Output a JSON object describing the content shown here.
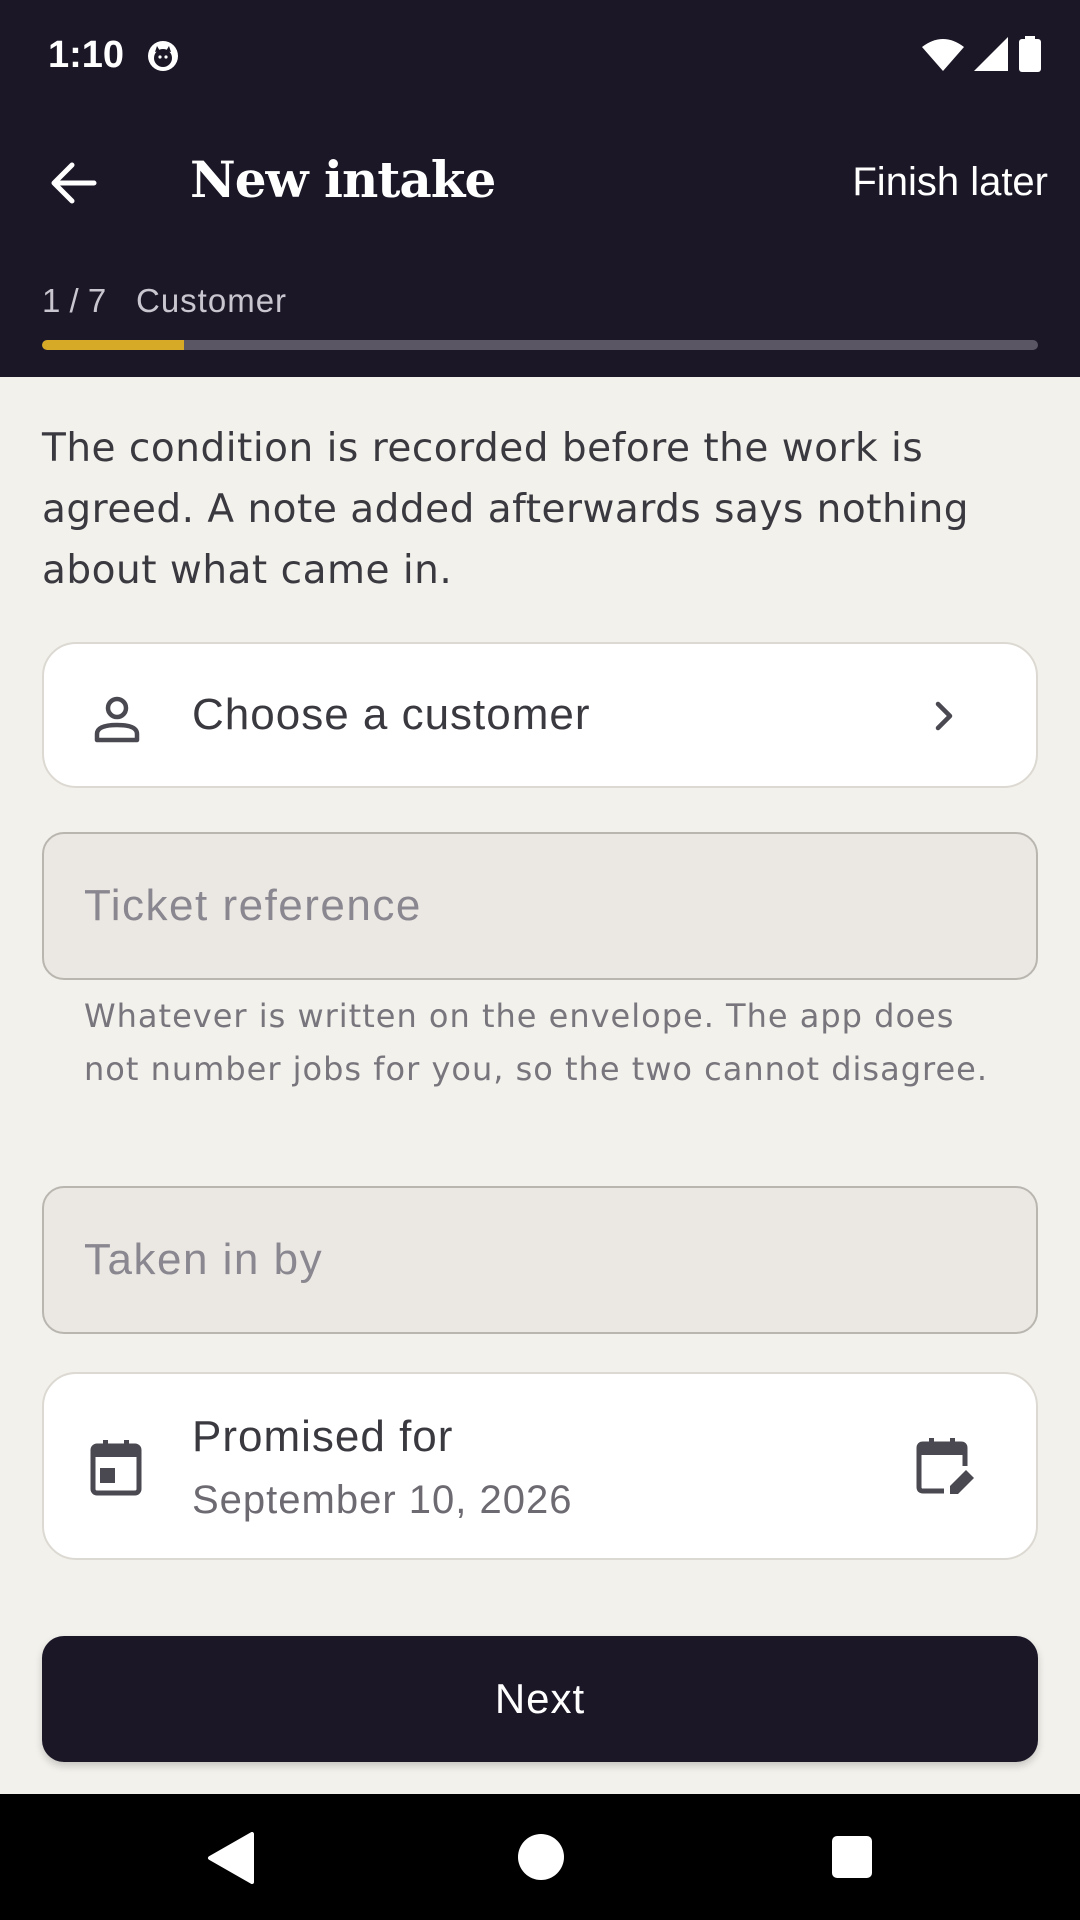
{
  "status_bar": {
    "time": "1:10"
  },
  "app_bar": {
    "title": "New intake",
    "finish_later": "Finish later"
  },
  "stepper": {
    "count": "1 / 7",
    "name": "Customer",
    "progress": 0.143,
    "track_color": "#5b5664",
    "fill_color": "#d6a927"
  },
  "intro_text": "The condition is recorded before the work is agreed. A note added afterwards says nothing about what came in.",
  "customer_picker": {
    "label": "Choose a customer",
    "icon": "person-icon"
  },
  "ticket_field": {
    "placeholder": "Ticket reference",
    "helper": "Whatever is written on the envelope. The app does not number jobs for you, so the two cannot disagree."
  },
  "taken_field": {
    "placeholder": "Taken in by"
  },
  "promised": {
    "label": "Promised for",
    "value": "September 10, 2026"
  },
  "next_button": {
    "label": "Next"
  },
  "colors": {
    "header_bg": "#1c1727",
    "page_bg": "#f3f1ec",
    "accent": "#d6a927"
  }
}
